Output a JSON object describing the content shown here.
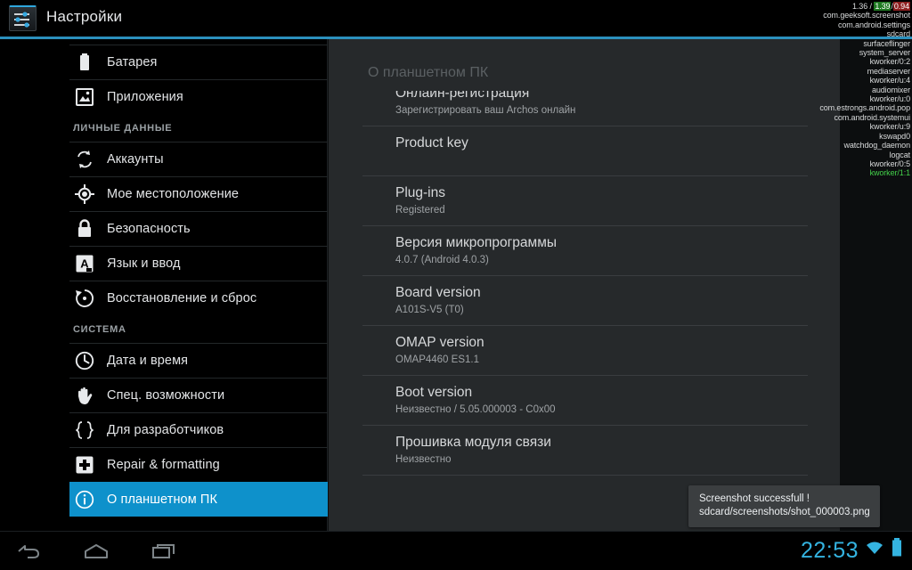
{
  "titlebar": {
    "app_title": "Настройки",
    "icon": "settings-sliders-icon",
    "accent_color": "#2b90bd"
  },
  "sidebar": {
    "items": [
      {
        "type": "item",
        "icon": "battery-icon",
        "label": "Батарея",
        "selected": false
      },
      {
        "type": "item",
        "icon": "apps-image-icon",
        "label": "Приложения",
        "selected": false
      },
      {
        "type": "header",
        "label": "ЛИЧНЫЕ ДАННЫЕ"
      },
      {
        "type": "item",
        "icon": "sync-accounts-icon",
        "label": "Аккаунты",
        "selected": false
      },
      {
        "type": "item",
        "icon": "location-target-icon",
        "label": "Мое местоположение",
        "selected": false
      },
      {
        "type": "item",
        "icon": "lock-icon",
        "label": "Безопасность",
        "selected": false
      },
      {
        "type": "item",
        "icon": "language-letter-a-icon",
        "label": "Язык и ввод",
        "selected": false
      },
      {
        "type": "item",
        "icon": "restore-reset-icon",
        "label": "Восстановление и сброс",
        "selected": false
      },
      {
        "type": "header",
        "label": "СИСТЕМА"
      },
      {
        "type": "item",
        "icon": "clock-icon",
        "label": "Дата и время",
        "selected": false
      },
      {
        "type": "item",
        "icon": "hand-accessibility-icon",
        "label": "Спец. возможности",
        "selected": false
      },
      {
        "type": "item",
        "icon": "curly-braces-developer-icon",
        "label": "Для разработчиков",
        "selected": false
      },
      {
        "type": "item",
        "icon": "repair-plus-icon",
        "label": "Repair & formatting",
        "selected": false
      },
      {
        "type": "item",
        "icon": "info-circle-icon",
        "label": "О планшетном ПК",
        "selected": true
      }
    ]
  },
  "content": {
    "title": "О планшетном ПК",
    "rows": [
      {
        "title": "Онлайн-регистрация",
        "sub": "Зарегистрировать ваш Archos онлайн",
        "clipped": true
      },
      {
        "title": "Product key",
        "sub": "",
        "obscured_sub": true
      },
      {
        "title": "Plug-ins",
        "sub": "Registered"
      },
      {
        "title": "Версия микропрограммы",
        "sub": "4.0.7  (Android 4.0.3)"
      },
      {
        "title": "Board version",
        "sub": "A101S-V5 (T0)"
      },
      {
        "title": "OMAP version",
        "sub": "OMAP4460 ES1.1"
      },
      {
        "title": "Boot version",
        "sub": "Неизвестно / 5.05.000003 - C0x00"
      },
      {
        "title": "Прошивка модуля связи",
        "sub": "Неизвестно"
      },
      {
        "title": "",
        "sub": "",
        "behind_toast": true
      }
    ]
  },
  "toast": {
    "line1": "Screenshot successfull  !",
    "line2": "sdcard/screenshots/shot_000003.png"
  },
  "cpu_overlay": {
    "load": {
      "one": "1.36",
      "five": "1.39",
      "fifteen": "0.94"
    },
    "processes": [
      {
        "name": "com.geeksoft.screenshot",
        "green": false
      },
      {
        "name": "com.android.settings",
        "green": false
      },
      {
        "name": "sdcard",
        "green": false
      },
      {
        "name": "surfaceflinger",
        "green": false
      },
      {
        "name": "system_server",
        "green": false
      },
      {
        "name": "kworker/0:2",
        "green": false
      },
      {
        "name": "mediaserver",
        "green": false
      },
      {
        "name": "kworker/u:4",
        "green": false
      },
      {
        "name": "audiomixer",
        "green": false
      },
      {
        "name": "kworker/u:0",
        "green": false
      },
      {
        "name": "com.estrongs.android.pop",
        "green": false
      },
      {
        "name": "com.android.systemui",
        "green": false
      },
      {
        "name": "kworker/u:9",
        "green": false
      },
      {
        "name": "kswapd0",
        "green": false
      },
      {
        "name": "watchdog_daemon",
        "green": false
      },
      {
        "name": "logcat",
        "green": false
      },
      {
        "name": "kworker/0:5",
        "green": false
      },
      {
        "name": "kworker/1:1",
        "green": true
      }
    ]
  },
  "sysbar": {
    "back_icon": "back-arrow-icon",
    "home_icon": "home-icon",
    "recents_icon": "recent-apps-icon",
    "clock": "22:53",
    "wifi_icon": "wifi-icon",
    "battery_icon": "battery-full-icon",
    "status_color": "#34b3e0"
  }
}
